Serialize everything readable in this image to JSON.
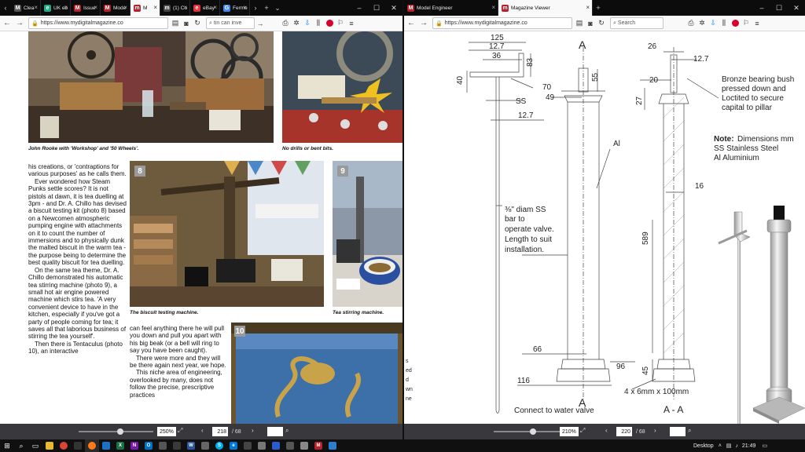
{
  "left": {
    "tabs": [
      {
        "label": "Clea",
        "favicon": "M",
        "color": "#555"
      },
      {
        "label": "UK eb",
        "favicon": "e",
        "color": "#2a8"
      },
      {
        "label": "Issue",
        "favicon": "M",
        "color": "#b8202a"
      },
      {
        "label": "Mode",
        "favicon": "M",
        "color": "#b8202a"
      },
      {
        "label": "M",
        "favicon": "m",
        "color": "#b8202a"
      },
      {
        "label": "(1) Co",
        "favicon": "m",
        "color": "#444"
      },
      {
        "label": "eBay",
        "favicon": "e",
        "color": "#e53238"
      },
      {
        "label": "Ferme",
        "favicon": "G",
        "color": "#4285f4"
      }
    ],
    "url": "https://www.mydigitalmagazine.co",
    "search": "tin can inve",
    "zoom": "250%",
    "page_number": "218",
    "page_total": "/ 68"
  },
  "right": {
    "tabs": [
      {
        "label": "Model Engineer",
        "favicon": "M",
        "color": "#b8202a"
      },
      {
        "label": "Magazine Viewer",
        "favicon": "m",
        "color": "#b8202a"
      }
    ],
    "url": "https://www.mydigitalmagazine.co",
    "search_placeholder": "Search",
    "zoom": "210%",
    "page_number": "220",
    "page_total": "/ 68"
  },
  "magazine": {
    "caption_top_left": "John Rooke with 'Workshop' and '50 Wheels'.",
    "caption_top_right": "No drills or bent bits.",
    "caption_biscuit": "The biscuit testing machine.",
    "caption_tea": "Tea stirring machine.",
    "photo8": "8",
    "photo9": "9",
    "photo10": "10",
    "col1": [
      "his creations, or 'contraptions for various purposes' as he calls them.",
      "Ever wondered how Steam Punks settle scores? It is not pistols at dawn, it is tea duelling at 3pm - and Dr. A. Chillo has devised a biscuit testing kit (photo 8) based on a Newcomen atmospheric pumping engine with attachments on it to count the number of immersions and to physically dunk the malted biscuit in the warm tea - the purpose being to determine the best quality biscuit for tea duelling.",
      "On the same tea theme, Dr. A. Chillo demonstrated his automatic tea stirring machine (photo 9), a small hot air engine powered machine which stirs tea. 'A very convenient device to have in the kitchen, especially if you've got a party of people coming for tea; it saves all that laborious business of stirring the tea yourself'.",
      "Then there is Tentaculus (photo 10), an interactive"
    ],
    "col2": [
      "can feel anything there he will pull you down and pull you apart with his big beak (or a bell will ring to say you have been caught).",
      "There were more and they will be there again next year, we hope.",
      "This niche area of engineering, overlooked by many, does not follow the precise, prescriptive practices"
    ],
    "edge_fragments": [
      "s",
      "ed",
      "d",
      "wn",
      "ne"
    ]
  },
  "drawing": {
    "dims": {
      "d125": "125",
      "d127a": "12.7",
      "d36": "36",
      "d83": "83",
      "d40": "40",
      "d55": "55",
      "d70": "70",
      "d49": "49",
      "d127b": "12.7",
      "d66": "66",
      "d96": "96",
      "d116": "116",
      "d26": "26",
      "d127c": "12.7",
      "d20": "20",
      "d27": "27",
      "d16": "16",
      "d589": "589",
      "d45": "45"
    },
    "label_A_left": "A",
    "label_A_bottom": "A",
    "label_AA": "A - A",
    "label_SS": "SS",
    "label_Al": "Al",
    "bronze_note": [
      "Bronze bearing bush",
      "pressed down and",
      "Loctited to secure",
      "capital to pillar"
    ],
    "note_title": "Note:",
    "note_lines": [
      "Dimensions mm",
      "SS Stainless Steel",
      "Al Aluminium"
    ],
    "valve_note": [
      "⅜\" diam SS",
      "bar to",
      "operate valve.",
      "Length to suit",
      "installation."
    ],
    "connect_note": "Connect to water valve",
    "slot_note": "4 x 6mm x 100mm"
  },
  "taskbar": {
    "desktop_label": "Desktop",
    "time": "21:49"
  },
  "colors": {
    "tabbar": "#0c0c0d",
    "toolbar": "#f9f9fa",
    "pdfbar": "#38383d",
    "taskbar": "#101010",
    "accent_red": "#b8202a"
  }
}
